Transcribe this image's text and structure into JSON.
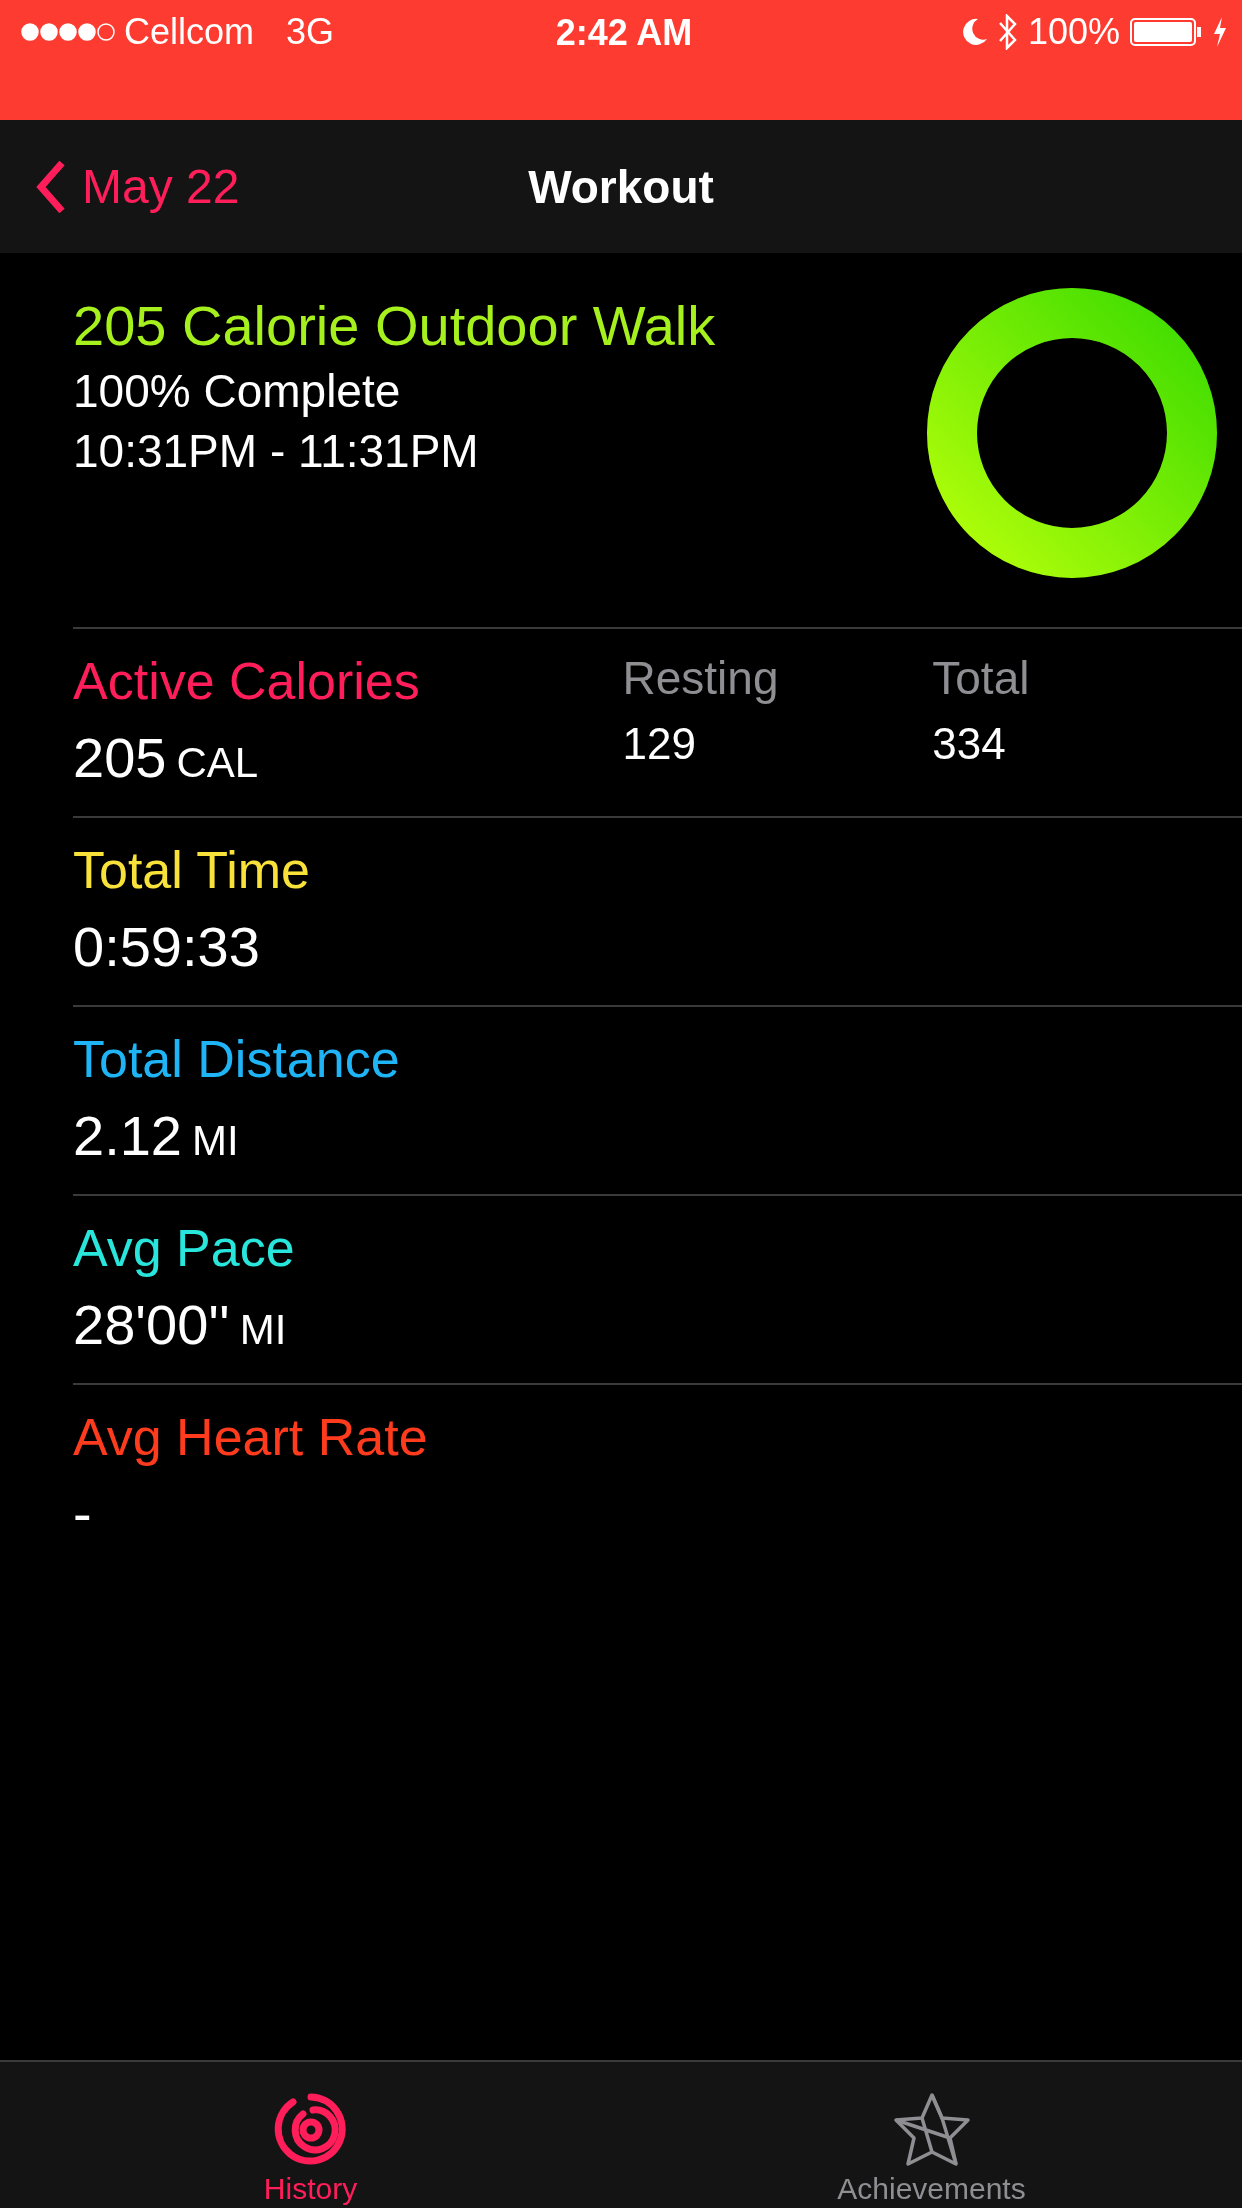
{
  "status_bar": {
    "carrier": "Cellcom",
    "network": "3G",
    "time": "2:42 AM",
    "battery": "100%"
  },
  "nav": {
    "back": "May 22",
    "title": "Workout"
  },
  "summary": {
    "title": "205 Calorie Outdoor Walk",
    "progress": "100% Complete",
    "time_range": "10:31PM - 11:31PM",
    "ring": {
      "level": 1
    }
  },
  "metrics": [
    {
      "kind": "split",
      "label": "Active Calories",
      "color": "#ff1e5a",
      "value": "205",
      "unit": "CAL",
      "columns": [
        {
          "label": "Resting",
          "value": "129"
        },
        {
          "label": "Total",
          "value": "334"
        }
      ]
    },
    {
      "kind": "single",
      "label": "Total Time",
      "color": "#f8e23a",
      "value": "0:59:33"
    },
    {
      "kind": "single",
      "label": "Total Distance",
      "color": "#1eb4f5",
      "value": "2.12",
      "unit": "MI"
    },
    {
      "kind": "single",
      "label": "Avg Pace",
      "color": "#28e6dc",
      "value": "28'00''",
      "unit": "MI"
    },
    {
      "kind": "single",
      "label": "Avg Heart Rate",
      "color": "#ff3b1e",
      "value": "-"
    }
  ],
  "tabs": [
    {
      "kind": "history",
      "label": "History",
      "selected": true
    },
    {
      "kind": "achievements",
      "label": "Achievements",
      "selected": false
    }
  ]
}
